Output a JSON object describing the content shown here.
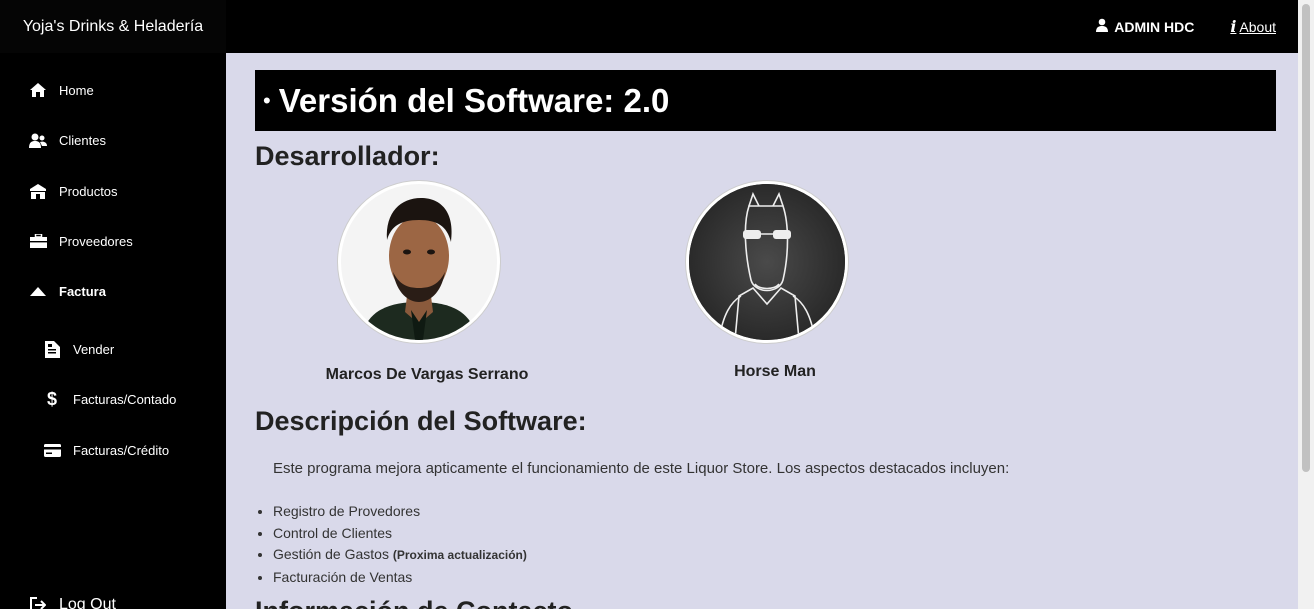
{
  "app": {
    "brand": "Yoja's Drinks & Heladería",
    "user_label": "ADMIN HDC",
    "about_label": "About"
  },
  "sidebar": {
    "items": [
      {
        "label": "Home",
        "icon": "home-icon"
      },
      {
        "label": "Clientes",
        "icon": "users-icon"
      },
      {
        "label": "Productos",
        "icon": "store-icon"
      },
      {
        "label": "Proveedores",
        "icon": "briefcase-icon"
      },
      {
        "label": "Factura",
        "icon": "caret-up-icon"
      }
    ],
    "sub_items": [
      {
        "label": "Vender",
        "icon": "document-icon"
      },
      {
        "label": "Facturas/Contado",
        "icon": "dollar-icon"
      },
      {
        "label": "Facturas/Crédito",
        "icon": "credit-card-icon"
      }
    ],
    "logout_label": "Log Out"
  },
  "main": {
    "version_title": "Versión del Software: 2.0",
    "developer_heading": "Desarrollador:",
    "developers": [
      {
        "name": "Marcos De Vargas Serrano"
      },
      {
        "name": "Horse Man"
      }
    ],
    "description_heading": "Descripción del Software:",
    "description_text": "Este programa mejora apticamente el funcionamiento de este Liquor Store. Los aspectos destacados incluyen:",
    "features": [
      {
        "text": "Registro de Provedores",
        "note": ""
      },
      {
        "text": "Control de Clientes",
        "note": ""
      },
      {
        "text": "Gestión de Gastos ",
        "note": "(Proxima actualización)"
      },
      {
        "text": "Facturación de Ventas",
        "note": ""
      }
    ],
    "contact_heading": "Información de Contacto"
  }
}
